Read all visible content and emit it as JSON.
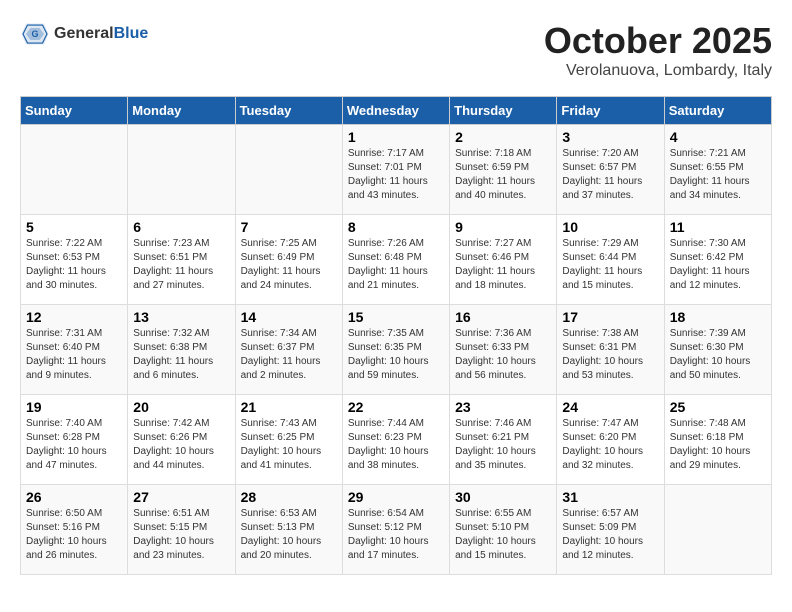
{
  "logo": {
    "general": "General",
    "blue": "Blue"
  },
  "header": {
    "title": "October 2025",
    "subtitle": "Verolanuova, Lombardy, Italy"
  },
  "weekdays": [
    "Sunday",
    "Monday",
    "Tuesday",
    "Wednesday",
    "Thursday",
    "Friday",
    "Saturday"
  ],
  "weeks": [
    [
      {
        "day": "",
        "info": ""
      },
      {
        "day": "",
        "info": ""
      },
      {
        "day": "",
        "info": ""
      },
      {
        "day": "1",
        "info": "Sunrise: 7:17 AM\nSunset: 7:01 PM\nDaylight: 11 hours\nand 43 minutes."
      },
      {
        "day": "2",
        "info": "Sunrise: 7:18 AM\nSunset: 6:59 PM\nDaylight: 11 hours\nand 40 minutes."
      },
      {
        "day": "3",
        "info": "Sunrise: 7:20 AM\nSunset: 6:57 PM\nDaylight: 11 hours\nand 37 minutes."
      },
      {
        "day": "4",
        "info": "Sunrise: 7:21 AM\nSunset: 6:55 PM\nDaylight: 11 hours\nand 34 minutes."
      }
    ],
    [
      {
        "day": "5",
        "info": "Sunrise: 7:22 AM\nSunset: 6:53 PM\nDaylight: 11 hours\nand 30 minutes."
      },
      {
        "day": "6",
        "info": "Sunrise: 7:23 AM\nSunset: 6:51 PM\nDaylight: 11 hours\nand 27 minutes."
      },
      {
        "day": "7",
        "info": "Sunrise: 7:25 AM\nSunset: 6:49 PM\nDaylight: 11 hours\nand 24 minutes."
      },
      {
        "day": "8",
        "info": "Sunrise: 7:26 AM\nSunset: 6:48 PM\nDaylight: 11 hours\nand 21 minutes."
      },
      {
        "day": "9",
        "info": "Sunrise: 7:27 AM\nSunset: 6:46 PM\nDaylight: 11 hours\nand 18 minutes."
      },
      {
        "day": "10",
        "info": "Sunrise: 7:29 AM\nSunset: 6:44 PM\nDaylight: 11 hours\nand 15 minutes."
      },
      {
        "day": "11",
        "info": "Sunrise: 7:30 AM\nSunset: 6:42 PM\nDaylight: 11 hours\nand 12 minutes."
      }
    ],
    [
      {
        "day": "12",
        "info": "Sunrise: 7:31 AM\nSunset: 6:40 PM\nDaylight: 11 hours\nand 9 minutes."
      },
      {
        "day": "13",
        "info": "Sunrise: 7:32 AM\nSunset: 6:38 PM\nDaylight: 11 hours\nand 6 minutes."
      },
      {
        "day": "14",
        "info": "Sunrise: 7:34 AM\nSunset: 6:37 PM\nDaylight: 11 hours\nand 2 minutes."
      },
      {
        "day": "15",
        "info": "Sunrise: 7:35 AM\nSunset: 6:35 PM\nDaylight: 10 hours\nand 59 minutes."
      },
      {
        "day": "16",
        "info": "Sunrise: 7:36 AM\nSunset: 6:33 PM\nDaylight: 10 hours\nand 56 minutes."
      },
      {
        "day": "17",
        "info": "Sunrise: 7:38 AM\nSunset: 6:31 PM\nDaylight: 10 hours\nand 53 minutes."
      },
      {
        "day": "18",
        "info": "Sunrise: 7:39 AM\nSunset: 6:30 PM\nDaylight: 10 hours\nand 50 minutes."
      }
    ],
    [
      {
        "day": "19",
        "info": "Sunrise: 7:40 AM\nSunset: 6:28 PM\nDaylight: 10 hours\nand 47 minutes."
      },
      {
        "day": "20",
        "info": "Sunrise: 7:42 AM\nSunset: 6:26 PM\nDaylight: 10 hours\nand 44 minutes."
      },
      {
        "day": "21",
        "info": "Sunrise: 7:43 AM\nSunset: 6:25 PM\nDaylight: 10 hours\nand 41 minutes."
      },
      {
        "day": "22",
        "info": "Sunrise: 7:44 AM\nSunset: 6:23 PM\nDaylight: 10 hours\nand 38 minutes."
      },
      {
        "day": "23",
        "info": "Sunrise: 7:46 AM\nSunset: 6:21 PM\nDaylight: 10 hours\nand 35 minutes."
      },
      {
        "day": "24",
        "info": "Sunrise: 7:47 AM\nSunset: 6:20 PM\nDaylight: 10 hours\nand 32 minutes."
      },
      {
        "day": "25",
        "info": "Sunrise: 7:48 AM\nSunset: 6:18 PM\nDaylight: 10 hours\nand 29 minutes."
      }
    ],
    [
      {
        "day": "26",
        "info": "Sunrise: 6:50 AM\nSunset: 5:16 PM\nDaylight: 10 hours\nand 26 minutes."
      },
      {
        "day": "27",
        "info": "Sunrise: 6:51 AM\nSunset: 5:15 PM\nDaylight: 10 hours\nand 23 minutes."
      },
      {
        "day": "28",
        "info": "Sunrise: 6:53 AM\nSunset: 5:13 PM\nDaylight: 10 hours\nand 20 minutes."
      },
      {
        "day": "29",
        "info": "Sunrise: 6:54 AM\nSunset: 5:12 PM\nDaylight: 10 hours\nand 17 minutes."
      },
      {
        "day": "30",
        "info": "Sunrise: 6:55 AM\nSunset: 5:10 PM\nDaylight: 10 hours\nand 15 minutes."
      },
      {
        "day": "31",
        "info": "Sunrise: 6:57 AM\nSunset: 5:09 PM\nDaylight: 10 hours\nand 12 minutes."
      },
      {
        "day": "",
        "info": ""
      }
    ]
  ]
}
